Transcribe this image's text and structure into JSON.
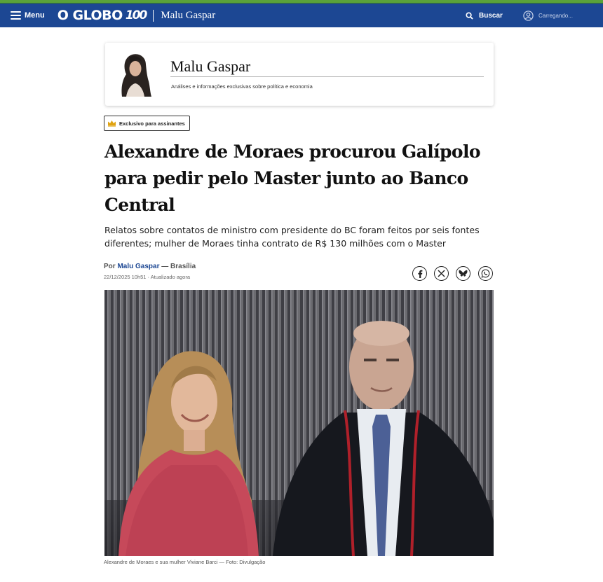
{
  "header": {
    "menu_label": "Menu",
    "logo_text": "O GLOBO",
    "logo_badge": "100",
    "column_name": "Malu Gaspar",
    "search_label": "Buscar",
    "account_label": "Carregando...",
    "bar_color": "#1c4793",
    "stripe_color": "#5aa33a"
  },
  "columnist": {
    "name": "Malu Gaspar",
    "description": "Análises e informações exclusivas sobre política e economia"
  },
  "article": {
    "badge": "Exclusivo para assinantes",
    "headline": "Alexandre de Moraes procurou Galípolo para pedir pelo Master junto ao Banco Central",
    "subheadline": "Relatos sobre contatos de ministro com presidente do BC foram feitos por seis fontes diferentes; mulher de Moraes tinha contrato de R$ 130 milhões com o Master",
    "byline_prefix": "Por",
    "author": "Malu Gaspar",
    "location": "— Brasília",
    "date": "22/12/2025 10h51 · Atualizado agora",
    "share_icons": [
      "facebook-icon",
      "x-icon",
      "bluesky-icon",
      "whatsapp-icon"
    ],
    "photo_caption": "Alexandre de Moraes e sua mulher Viviane Barci — Foto: Divulgação"
  }
}
